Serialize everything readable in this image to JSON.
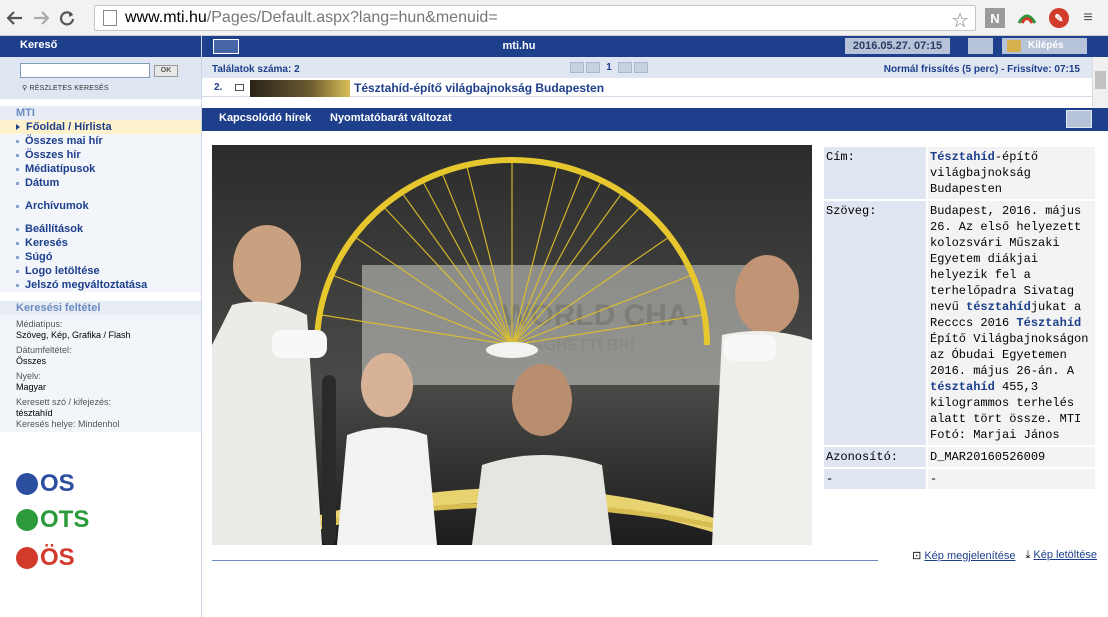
{
  "browser": {
    "url_host": "www.mti.hu",
    "url_path": "/Pages/Default.aspx?lang=hun&menuid=",
    "extension_n": "N"
  },
  "sidebar": {
    "search_title": "Kereső",
    "ok_label": "OK",
    "advanced_label": "RÉSZLETES KERESÉS",
    "mti_title": "MTI",
    "menu_primary": [
      {
        "label": "Főoldal / Hírlista",
        "active": true
      },
      {
        "label": "Összes mai hír"
      },
      {
        "label": "Összes hír"
      },
      {
        "label": "Médiatípusok"
      },
      {
        "label": "Dátum"
      }
    ],
    "archive_label": "Archívumok",
    "menu_secondary": [
      {
        "label": "Beállítások"
      },
      {
        "label": "Keresés"
      },
      {
        "label": "Súgó"
      },
      {
        "label": "Logo letöltése"
      },
      {
        "label": "Jelszó megváltoztatása"
      }
    ],
    "criteria_title": "Keresési feltétel",
    "criteria": {
      "media_label": "Médiatípus:",
      "media_value": "Szöveg, Kép, Grafika / Flash",
      "date_label": "Dátumfeltétel:",
      "date_value": "Összes",
      "lang_label": "Nyelv:",
      "lang_value": "Magyar",
      "term_label": "Keresett szó / kifejezés:",
      "term_value": "tésztahíd",
      "place_label": "Keresés helye: Mindenhol"
    },
    "logos": [
      {
        "text": "OS",
        "color": "#2d4fa0"
      },
      {
        "text": "OTS",
        "color": "#2a9a3a"
      },
      {
        "text": "ÖS",
        "color": "#d23a2c"
      }
    ]
  },
  "main": {
    "site_title": "mti.hu",
    "datetime": "2016.05.27. 07:15",
    "logout_label": "Kilépés",
    "results_count": "Találatok száma: 2",
    "current_page": "1",
    "refresh_text": "Normál frissítés (5 perc) - Frissítve: 07:15",
    "result": {
      "num": "2.",
      "title_kw": "Tésztahíd",
      "title_rest": "-építő világbajnokság Budapesten"
    },
    "toolbar": {
      "related": "Kapcsolódó hírek",
      "print_version": "Nyomtatóbarát változat"
    },
    "details": {
      "title_label": "Cím:",
      "title_kw": "Tésztahíd",
      "title_rest": "-építő világbajnokság Budapesten",
      "text_label": "Szöveg:",
      "text_p1": "Budapest, 2016. május 26. Az első helyezett kolozsvári Műszaki Egyetem diákjai helyezik fel a terhelőpadra Sivatag nevű ",
      "text_kw1": "tésztahíd",
      "text_p2": "jukat a Recccs 2016 ",
      "text_kw2": "Tésztahíd",
      "text_p3": " Építő Világbajnokságon az Óbudai Egyetemen 2016. május 26-án. A ",
      "text_kw3": "tésztahíd",
      "text_p4": " 455,3 kilogrammos terhelés alatt tört össze. MTI Fotó: Marjai János",
      "id_label": "Azonosító:",
      "id_value": "D_MAR20160526009",
      "extra_label": "-",
      "extra_value": "-"
    },
    "photo_banner_line1": "WORLD CHA",
    "photo_banner_line2": "SPAGHETTI BRI",
    "links": {
      "view": "Kép megjelenítése",
      "download": "Kép letöltése"
    }
  }
}
